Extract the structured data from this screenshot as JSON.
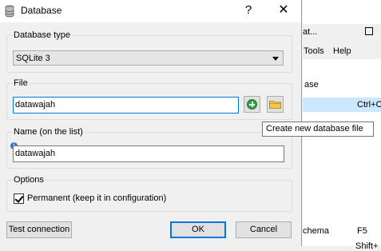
{
  "dialog": {
    "title": "Database",
    "help_glyph": "?",
    "close_glyph": "✕"
  },
  "database_type": {
    "group_label": "Database type",
    "selected": "SQLite 3"
  },
  "file": {
    "group_label": "File",
    "value": "datawajah",
    "tooltip": "Create new database file"
  },
  "name": {
    "group_label": "Name (on the list)",
    "value": "datawajah"
  },
  "options": {
    "group_label": "Options",
    "permanent_label": "Permanent (keep it in configuration)",
    "permanent_checked": true
  },
  "buttons": {
    "test": "Test connection",
    "ok": "OK",
    "cancel": "Cancel"
  },
  "background_app": {
    "title_fragment": "at...",
    "menu_tools": "Tools",
    "menu_help": "Help",
    "item_fragment": "ase",
    "shortcut_1": "Ctrl+C",
    "item_schema": "chema",
    "shortcut_f5": "F5",
    "shortcut_shift": "Shift+"
  },
  "colors": {
    "accent": "#0078d7",
    "selection": "#cce8ff",
    "add_green": "#2ea043"
  }
}
